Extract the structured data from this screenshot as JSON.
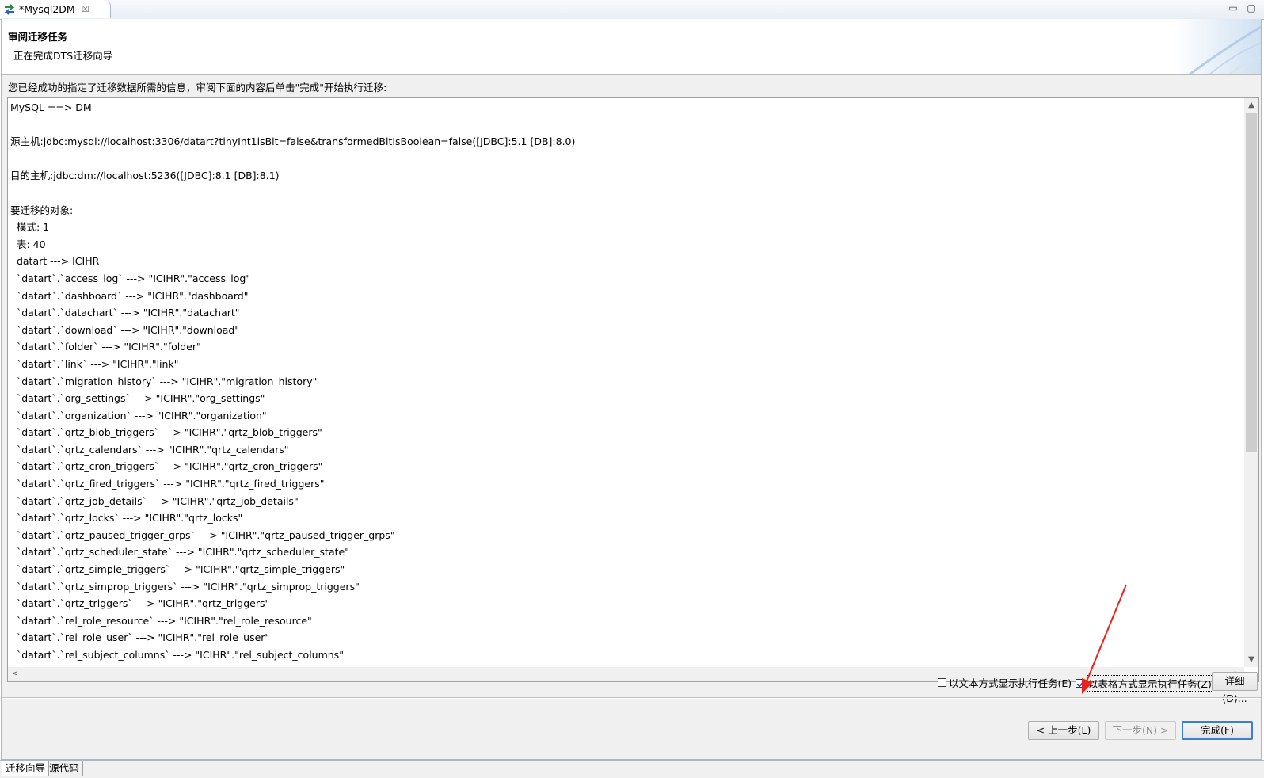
{
  "editor_tab": {
    "title": "*Mysql2DM",
    "close": "☒"
  },
  "window_controls": {
    "minimize": "▭",
    "maximize": "▢"
  },
  "banner": {
    "title": "审阅迁移任务",
    "subtitle": "正在完成DTS迁移向导"
  },
  "intro": "您已经成功的指定了迁移数据所需的信息，审阅下面的内容后单击\"完成\"开始执行迁移:",
  "summary_lines": [
    "MySQL ==> DM",
    "",
    "源主机:jdbc:mysql://localhost:3306/datart?tinyInt1isBit=false&transformedBitIsBoolean=false([JDBC]:5.1 [DB]:8.0)",
    "",
    "目的主机:jdbc:dm://localhost:5236([JDBC]:8.1 [DB]:8.1)",
    "",
    "要迁移的对象:",
    "  模式: 1",
    "  表: 40",
    "  datart ---> ICIHR",
    "  `datart`.`access_log` ---> \"ICIHR\".\"access_log\"",
    "  `datart`.`dashboard` ---> \"ICIHR\".\"dashboard\"",
    "  `datart`.`datachart` ---> \"ICIHR\".\"datachart\"",
    "  `datart`.`download` ---> \"ICIHR\".\"download\"",
    "  `datart`.`folder` ---> \"ICIHR\".\"folder\"",
    "  `datart`.`link` ---> \"ICIHR\".\"link\"",
    "  `datart`.`migration_history` ---> \"ICIHR\".\"migration_history\"",
    "  `datart`.`org_settings` ---> \"ICIHR\".\"org_settings\"",
    "  `datart`.`organization` ---> \"ICIHR\".\"organization\"",
    "  `datart`.`qrtz_blob_triggers` ---> \"ICIHR\".\"qrtz_blob_triggers\"",
    "  `datart`.`qrtz_calendars` ---> \"ICIHR\".\"qrtz_calendars\"",
    "  `datart`.`qrtz_cron_triggers` ---> \"ICIHR\".\"qrtz_cron_triggers\"",
    "  `datart`.`qrtz_fired_triggers` ---> \"ICIHR\".\"qrtz_fired_triggers\"",
    "  `datart`.`qrtz_job_details` ---> \"ICIHR\".\"qrtz_job_details\"",
    "  `datart`.`qrtz_locks` ---> \"ICIHR\".\"qrtz_locks\"",
    "  `datart`.`qrtz_paused_trigger_grps` ---> \"ICIHR\".\"qrtz_paused_trigger_grps\"",
    "  `datart`.`qrtz_scheduler_state` ---> \"ICIHR\".\"qrtz_scheduler_state\"",
    "  `datart`.`qrtz_simple_triggers` ---> \"ICIHR\".\"qrtz_simple_triggers\"",
    "  `datart`.`qrtz_simprop_triggers` ---> \"ICIHR\".\"qrtz_simprop_triggers\"",
    "  `datart`.`qrtz_triggers` ---> \"ICIHR\".\"qrtz_triggers\"",
    "  `datart`.`rel_role_resource` ---> \"ICIHR\".\"rel_role_resource\"",
    "  `datart`.`rel_role_user` ---> \"ICIHR\".\"rel_role_user\"",
    "  `datart`.`rel_subject_columns` ---> \"ICIHR\".\"rel_subject_columns\""
  ],
  "scroll_arrows": {
    "up": "▲",
    "down": "▼",
    "left": "<",
    "right": ">"
  },
  "options": {
    "text_mode_label": "以文本方式显示执行任务(E)",
    "text_mode_checked": false,
    "table_mode_label": "以表格方式显示执行任务(Z)",
    "table_mode_checked": true,
    "details_button": "详细(D)..."
  },
  "buttons": {
    "back": "< 上一步(L)",
    "next": "下一步(N) >",
    "finish": "完成(F)"
  },
  "page_tabs": [
    "迁移向导",
    "源代码"
  ],
  "colors": {
    "annotation_arrow": "#e8231a",
    "frame_border": "#a9b8cc",
    "default_button_border": "#3c7fd1"
  }
}
